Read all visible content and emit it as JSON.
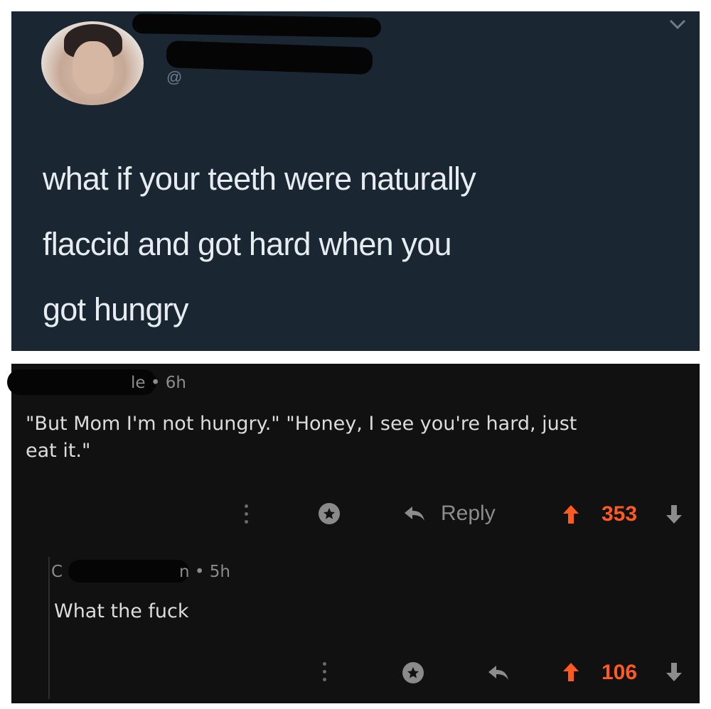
{
  "tweet": {
    "handle_fragment": "@ ",
    "text": "what if your teeth were naturally flaccid and got hard when you got hungry",
    "lines": [
      "what if your teeth were naturally",
      "flaccid and got hard when you",
      "got hungry"
    ],
    "menu_icon": "chevron-down-icon",
    "colors": {
      "background": "#1b2633",
      "text": "#e6ecf0"
    }
  },
  "comments": [
    {
      "author_fragment": "le",
      "age": "6h",
      "meta": "le • 6h",
      "text_lines": [
        "\"But Mom I'm not hungry.\" \"Honey, I see you're hard, just",
        "eat it.\""
      ],
      "reply_label": "Reply",
      "score": "353"
    },
    {
      "author_fragment_start": "C",
      "author_fragment_end": "n",
      "age": "5h",
      "meta_start": "C",
      "meta_end": "n • 5h",
      "text": "What the fuck",
      "score": "106"
    }
  ],
  "colors": {
    "comment_background": "#111112",
    "upvote": "#ff5a1f",
    "muted": "#8c8c8c"
  }
}
